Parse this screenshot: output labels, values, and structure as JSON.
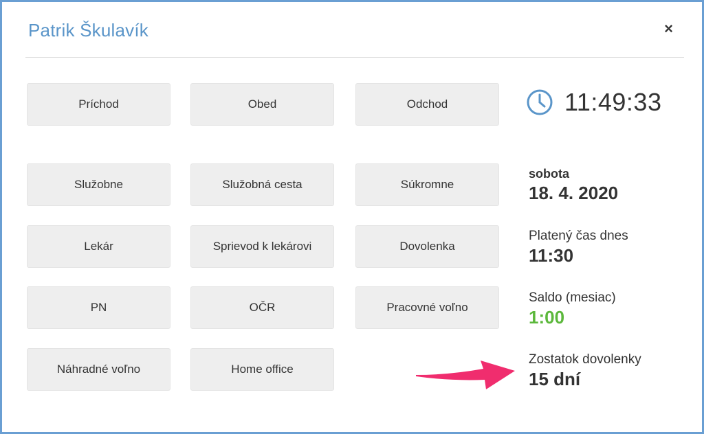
{
  "dialog": {
    "title": "Patrik Škulavík",
    "close_label": "×"
  },
  "buttons": {
    "prichod": "Príchod",
    "obed": "Obed",
    "odchod": "Odchod",
    "sluzobne": "Služobne",
    "sluzobna_cesta": "Služobná cesta",
    "sukromne": "Súkromne",
    "lekar": "Lekár",
    "sprievod": "Sprievod k lekárovi",
    "dovolenka": "Dovolenka",
    "pn": "PN",
    "ocr": "OČR",
    "pracovne_volno": "Pracovné voľno",
    "nahradne_volno": "Náhradné voľno",
    "home_office": "Home office"
  },
  "clock": {
    "icon": "clock-icon",
    "time": "11:49:33",
    "color": "#5a95c9"
  },
  "date": {
    "weekday": "sobota",
    "value": "18. 4. 2020"
  },
  "paid_time": {
    "label": "Platený čas dnes",
    "value": "11:30"
  },
  "balance": {
    "label": "Saldo (mesiac)",
    "value": "1:00",
    "color": "#5cb83c"
  },
  "vacation": {
    "label": "Zostatok dovolenky",
    "value": "15 dní"
  },
  "annotation": {
    "icon": "arrow-icon",
    "color": "#f02d6e"
  }
}
